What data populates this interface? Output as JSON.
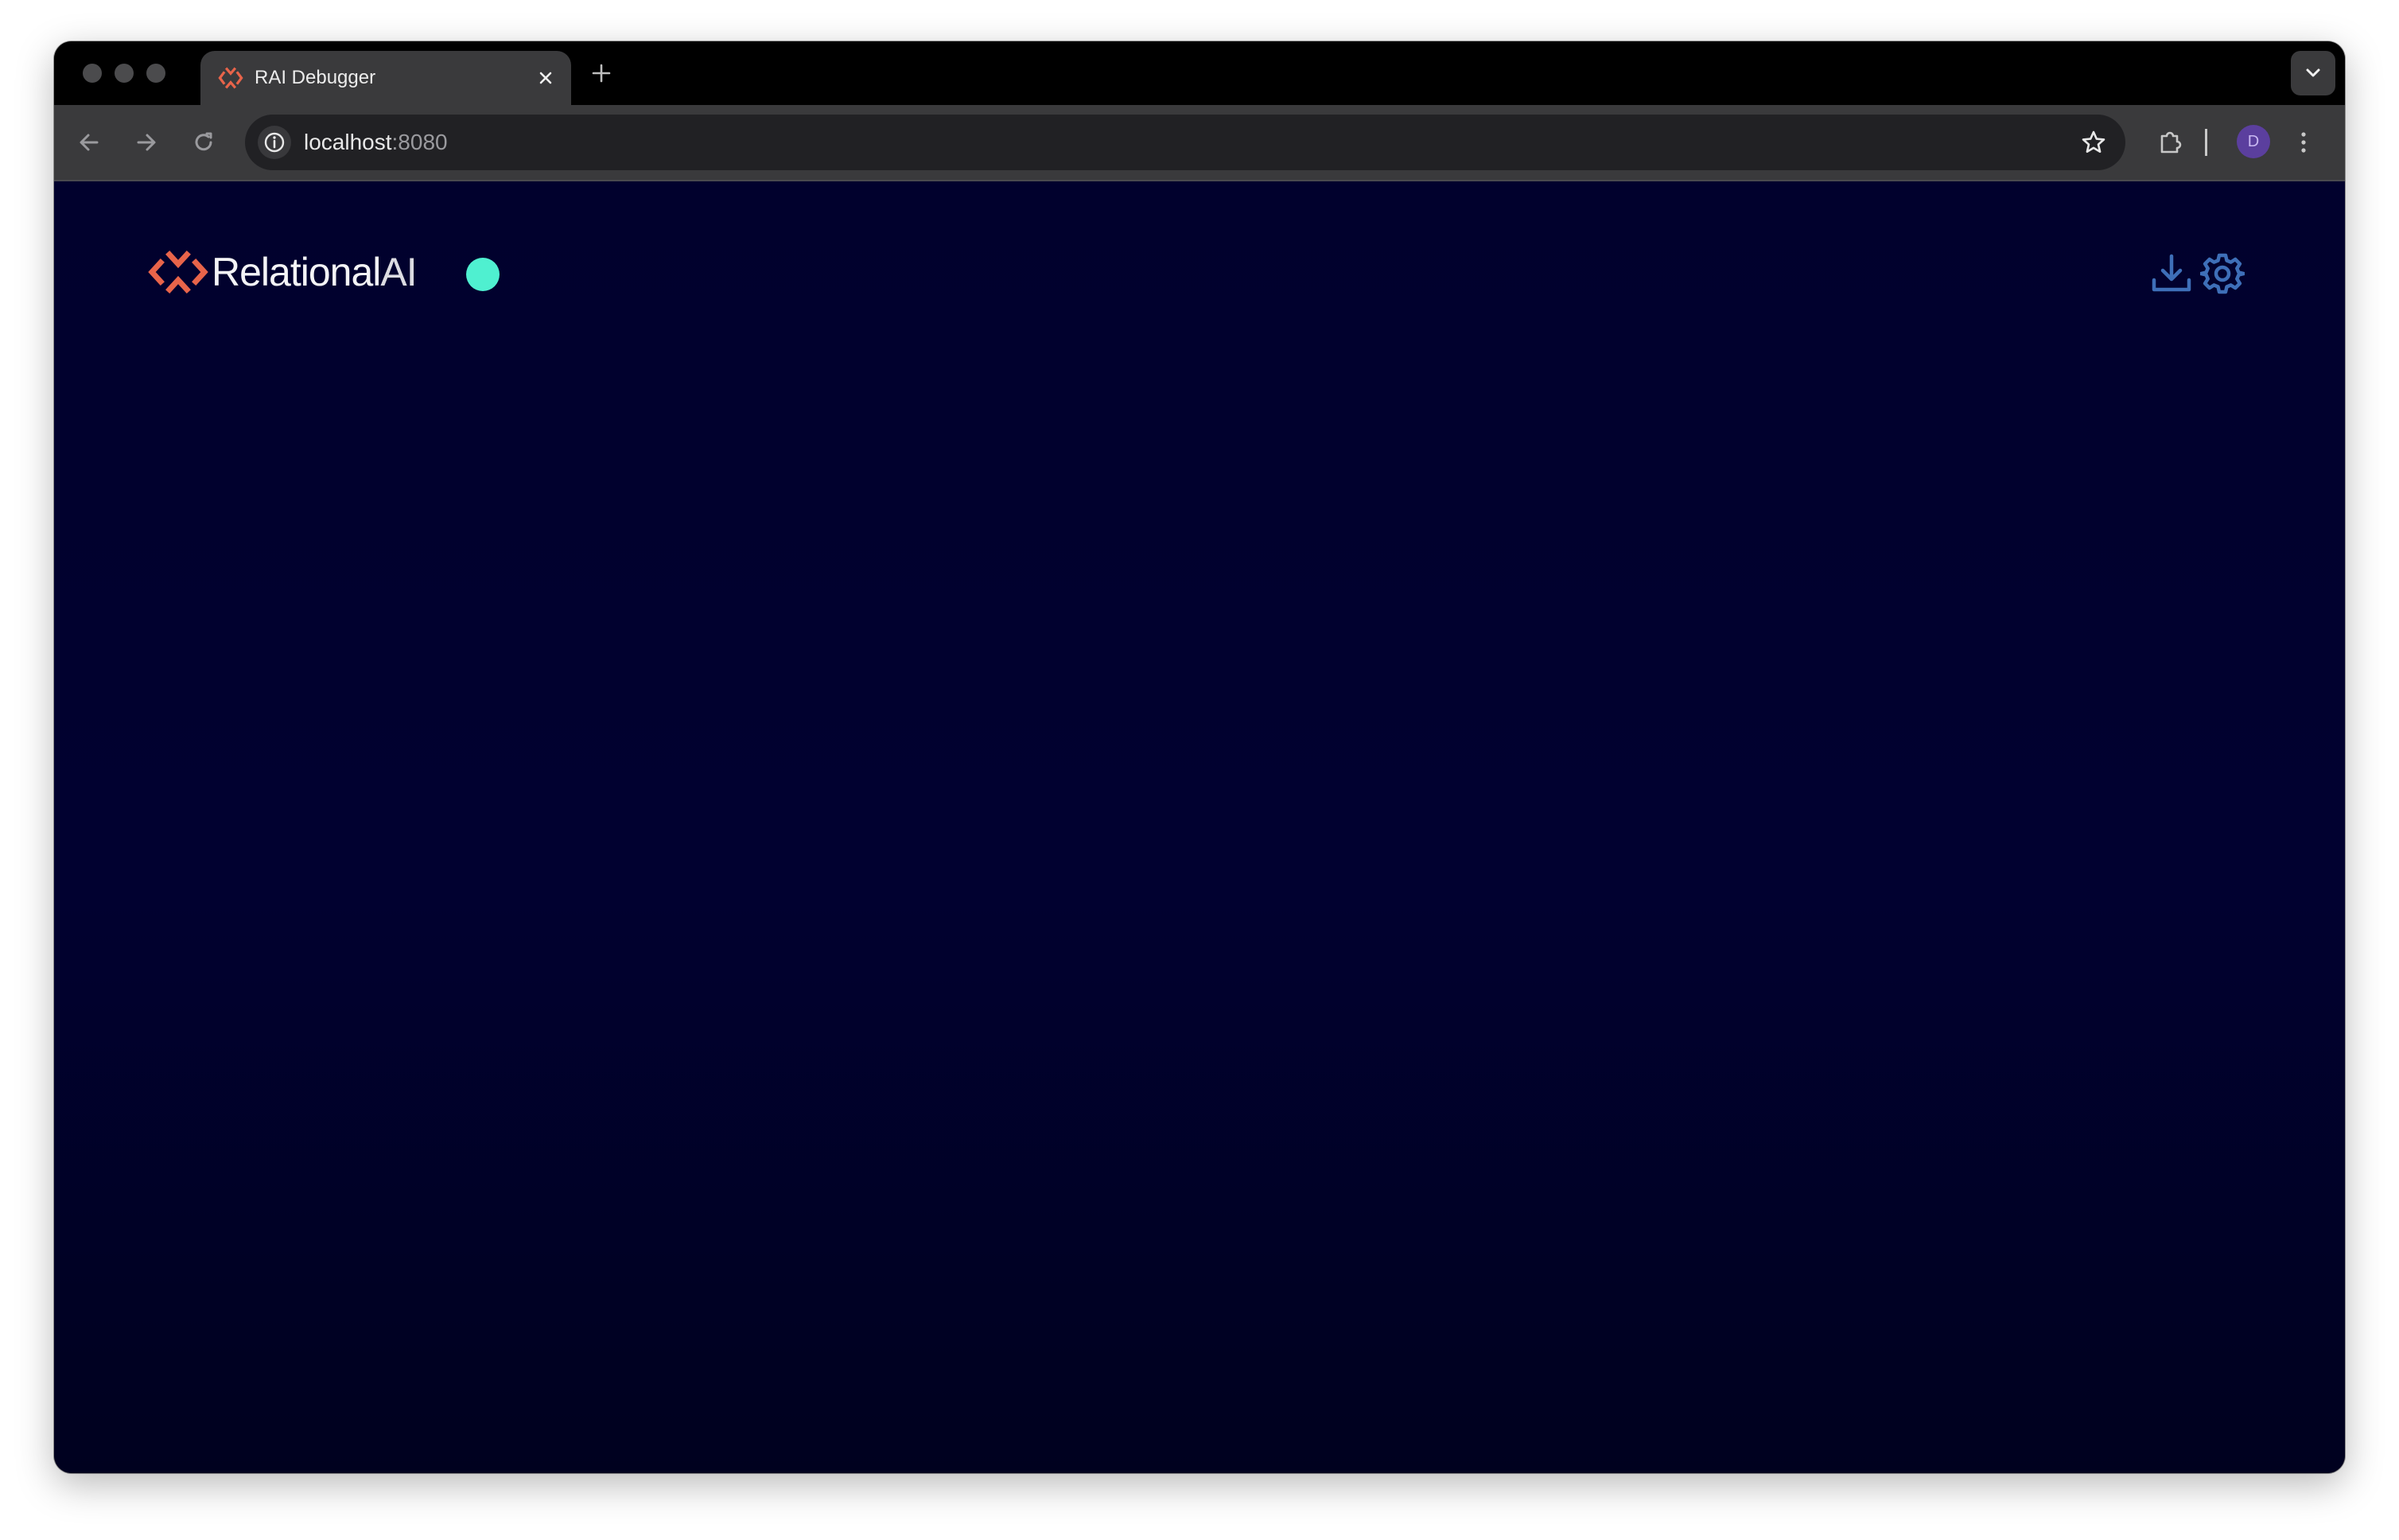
{
  "browser": {
    "tab": {
      "title": "RAI Debugger",
      "close_icon": "close-icon",
      "favicon": "relationalai-logo-icon"
    },
    "new_tab_icon": "plus-icon",
    "tab_search_icon": "chevron-down-icon",
    "toolbar": {
      "back_icon": "arrow-left-icon",
      "forward_icon": "arrow-right-icon",
      "reload_icon": "reload-icon",
      "site_info_icon": "info-icon",
      "url_host": "localhost",
      "url_port": ":8080",
      "bookmark_icon": "star-icon",
      "extensions_icon": "puzzle-icon",
      "profile_initial": "D",
      "menu_icon": "kebab-menu-icon"
    }
  },
  "app": {
    "logo": {
      "brand_main": "Relational",
      "brand_suffix": "AI",
      "mark_color": "#e8644a"
    },
    "status": {
      "color": "#4ff0d0"
    },
    "actions": {
      "download_icon": "download-icon",
      "settings_icon": "gear-icon",
      "icon_color": "#3e6fb8"
    }
  },
  "colors": {
    "page_bg": "#01012d",
    "chrome_bg": "#000000",
    "toolbar_bg": "#3a3a3c"
  }
}
